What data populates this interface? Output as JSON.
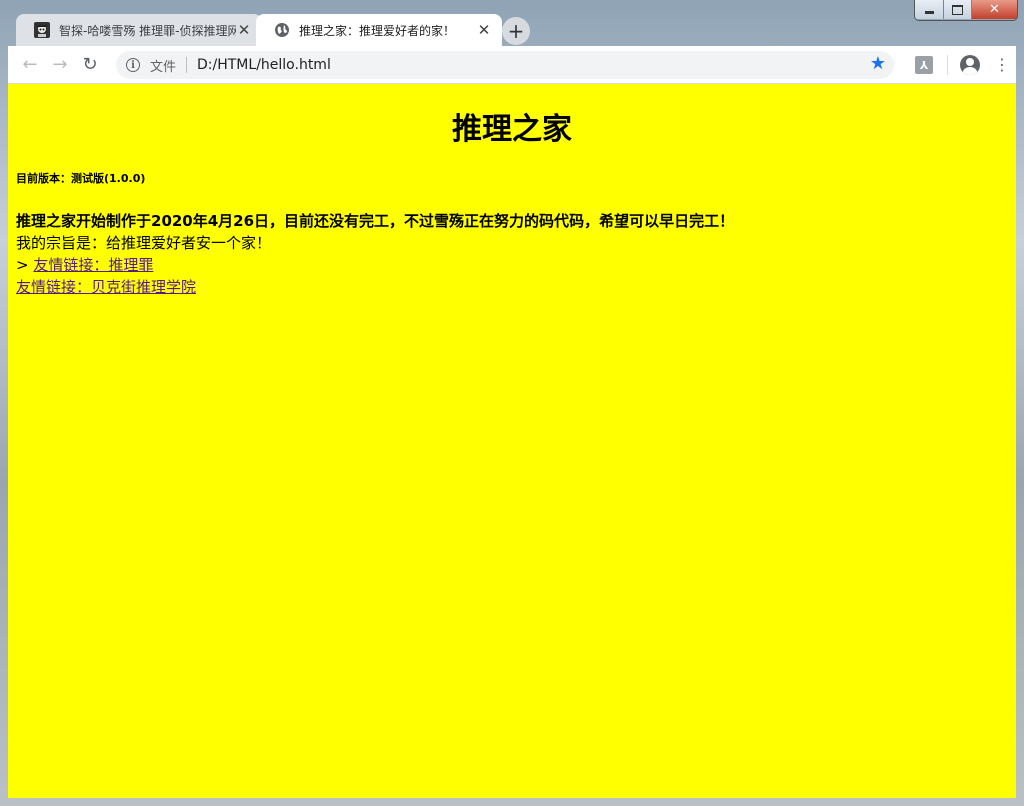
{
  "browser": {
    "tabs": [
      {
        "title": "智探-哈喽雪殇 推理罪-侦探推理网",
        "favicon": "detective-icon",
        "active": false
      },
      {
        "title": "推理之家：推理爱好者的家！",
        "favicon": "globe-icon",
        "active": true
      }
    ],
    "omnibox": {
      "security_label": "文件",
      "url": "D:/HTML/hello.html"
    }
  },
  "page": {
    "background": "#ffff00",
    "title": "推理之家",
    "version": "目前版本：测试版(1.0.0)",
    "intro": "推理之家开始制作于2020年4月26日，目前还没有完工，不过雪殇正在努力的码代码，希望可以早日完工！",
    "mission": "我的宗旨是：给推理爱好者安一个家！",
    "link_prefix": ">",
    "links": [
      {
        "text": "友情链接：推理罪"
      },
      {
        "text": "友情链接：贝克街推理学院"
      }
    ]
  }
}
